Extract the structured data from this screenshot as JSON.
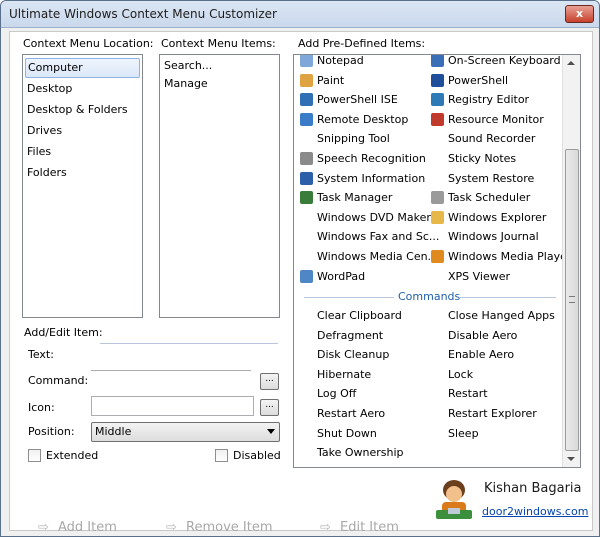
{
  "window": {
    "title": "Ultimate Windows Context Menu Customizer",
    "close_label": "x"
  },
  "locations": {
    "heading": "Context Menu Location:",
    "items": [
      "Computer",
      "Desktop",
      "Desktop & Folders",
      "Drives",
      "Files",
      "Folders"
    ],
    "selected": "Computer"
  },
  "menu_items": {
    "heading": "Context Menu Items:",
    "items": [
      "Search...",
      "Manage"
    ]
  },
  "predefined": {
    "heading": "Add Pre-Defined Items:",
    "left": [
      {
        "label": "Notepad",
        "icon": "notepad-icon",
        "color": "#7fa8d8"
      },
      {
        "label": "Paint",
        "icon": "paint-icon",
        "color": "#e0a341"
      },
      {
        "label": "PowerShell ISE",
        "icon": "powershell-ise-icon",
        "color": "#2f6fb3"
      },
      {
        "label": "Remote Desktop",
        "icon": "remote-desktop-icon",
        "color": "#3a7cc7"
      },
      {
        "label": "Snipping Tool",
        "icon": "",
        "color": ""
      },
      {
        "label": "Speech Recognition",
        "icon": "microphone-icon",
        "color": "#8a8a8a"
      },
      {
        "label": "System Information",
        "icon": "system-info-icon",
        "color": "#2d5fa8"
      },
      {
        "label": "Task Manager",
        "icon": "task-manager-icon",
        "color": "#3a7c3a"
      },
      {
        "label": "Windows DVD Maker",
        "icon": "",
        "color": ""
      },
      {
        "label": "Windows Fax and Sc...",
        "icon": "",
        "color": ""
      },
      {
        "label": "Windows Media Cen...",
        "icon": "",
        "color": ""
      },
      {
        "label": "WordPad",
        "icon": "wordpad-icon",
        "color": "#4f86c6"
      }
    ],
    "right": [
      {
        "label": "On-Screen Keyboard",
        "icon": "keyboard-icon",
        "color": "#3a6fb8"
      },
      {
        "label": "PowerShell",
        "icon": "powershell-icon",
        "color": "#1f4f9a"
      },
      {
        "label": "Registry Editor",
        "icon": "registry-icon",
        "color": "#2c7bb6"
      },
      {
        "label": "Resource Monitor",
        "icon": "resource-monitor-icon",
        "color": "#c0392b"
      },
      {
        "label": "Sound Recorder",
        "icon": "",
        "color": ""
      },
      {
        "label": "Sticky Notes",
        "icon": "",
        "color": ""
      },
      {
        "label": "System Restore",
        "icon": "",
        "color": ""
      },
      {
        "label": "Task Scheduler",
        "icon": "clock-icon",
        "color": "#9a9a9a"
      },
      {
        "label": "Windows Explorer",
        "icon": "folder-icon",
        "color": "#e6b84a"
      },
      {
        "label": "Windows Journal",
        "icon": "",
        "color": ""
      },
      {
        "label": "Windows Media Player",
        "icon": "media-player-icon",
        "color": "#e08a1e"
      },
      {
        "label": "XPS Viewer",
        "icon": "",
        "color": ""
      }
    ],
    "commands_heading": "Commands",
    "commands_left": [
      "Clear Clipboard",
      "Defragment",
      "Disk Cleanup",
      "Hibernate",
      "Log Off",
      "Restart Aero",
      "Shut Down",
      "Take Ownership"
    ],
    "commands_right": [
      "Close Hanged Apps",
      "Disable Aero",
      "Enable Aero",
      "Lock",
      "Restart",
      "Restart Explorer",
      "Sleep"
    ]
  },
  "form": {
    "heading": "Add/Edit Item:",
    "text_label": "Text:",
    "command_label": "Command:",
    "icon_label": "Icon:",
    "position_label": "Position:",
    "position_value": "Middle",
    "extended_label": "Extended",
    "disabled_label": "Disabled",
    "browse_label": "..."
  },
  "actions": {
    "add": "Add Item",
    "remove": "Remove Item",
    "edit": "Edit Item"
  },
  "author": {
    "name": "Kishan Bagaria",
    "link": "door2windows.com"
  }
}
